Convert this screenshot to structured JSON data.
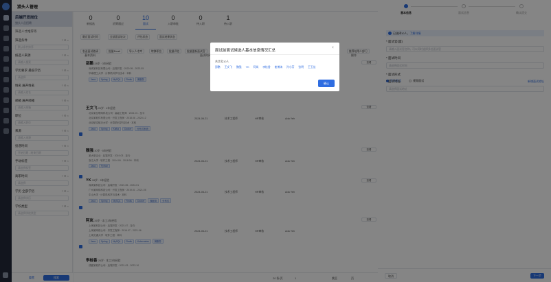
{
  "app": {
    "title": "猎头人管理"
  },
  "job": {
    "name": "后端开发岗位",
    "sub": "猎头人员招聘"
  },
  "filters": {
    "head": "筛选人才推荐等",
    "groups": [
      {
        "label": "筛选条件",
        "placeholder": "默认条件排序"
      },
      {
        "label": "候选人来源",
        "placeholder": "请输入搜索"
      },
      {
        "label": "学历要求 最低学历",
        "placeholder": "请选择"
      },
      {
        "label": "姓名 展开姓名",
        "placeholder": "请输入姓名"
      },
      {
        "label": "邮箱 展开邮箱",
        "placeholder": "请输入邮箱"
      },
      {
        "label": "职位",
        "placeholder": "请输入职位"
      },
      {
        "label": "来源",
        "placeholder": "请输入来源"
      },
      {
        "label": "投递时间",
        "placeholder": "开始日期 - 结束日期"
      },
      {
        "label": "手动标签",
        "placeholder": "请选择标签"
      },
      {
        "label": "离职时间",
        "placeholder": "请选择"
      },
      {
        "label": "学历 全部学历",
        "placeholder": "请选择学历"
      },
      {
        "label": "学校类型",
        "placeholder": "请选择学校类型"
      }
    ],
    "reset": "重置",
    "search": "搜索"
  },
  "stages": [
    {
      "num": "0",
      "label": "新候选"
    },
    {
      "num": "0",
      "label": "初筛通过"
    },
    {
      "num": "10",
      "label": "面试"
    },
    {
      "num": "0",
      "label": "入职审批"
    },
    {
      "num": "0",
      "label": "待入职"
    },
    {
      "num": "1",
      "label": "待入职"
    }
  ],
  "dropdowns": [
    "最近面试时间",
    "全部面试轮次",
    "评估状态",
    "面试结果状态"
  ],
  "tools": [
    "发送面试邀请",
    "批量Email",
    "导入人才库",
    "转移职位",
    "批量评估",
    "批量更新面试官",
    "筛选候选人",
    "推荐给用人部门"
  ],
  "colhead": {
    "name": "基本资料",
    "time": "面试时间",
    "pos": "应聘职位",
    "stage": "当前阶段",
    "owner": "推荐人",
    "action": "操作"
  },
  "candidates": [
    {
      "name": "邵鹏",
      "meta": "28岁 · 3年经验",
      "lines": [
        "深圳某科技有限公司 · 后端开发 · 2020.05 - 2023.05",
        "华南理工大学 · 计算机科学与技术 · 本科"
      ],
      "tags": [
        "Java",
        "Spring",
        "MySQL",
        "Redis",
        "微服务"
      ],
      "time": "",
      "pos": "",
      "stage": "",
      "owner": "",
      "action": "查看"
    },
    {
      "name": "王文飞",
      "meta": "26岁 · 4年经验",
      "lines": [
        "北京某互联网科技公司 · 高级工程师 · 2021.01 - 至今",
        "北京某软件有限公司 · 开发工程师 · 2018.06 - 2020.12",
        "北京航空航天大学 · 计算机科学与技术 · 本科"
      ],
      "tags": [
        "Java",
        "Spring",
        "Kafka",
        "Docker",
        "分布式系统"
      ],
      "time": "2024-06-21",
      "pos": "技术工程师",
      "stage": "HR审核",
      "owner": "Ada Yeh",
      "action": "查看"
    },
    {
      "name": "魏强",
      "meta": "30岁 · 5年经验",
      "lines": [
        "某大型企业 · 后端开发 · 2019.03 - 至今",
        "浙江大学 · 软件工程 · 2014.09 - 2018.06 · 本科"
      ],
      "tags": [
        "Java",
        "Python"
      ],
      "time": "2024-06-21",
      "pos": "技术工程师",
      "stage": "HR审核",
      "owner": "Ada Yeh",
      "action": "查看"
    },
    {
      "name": "YK",
      "meta": "28岁 · 3年经验",
      "lines": [
        "深圳某科技公司 · 后端开发 · 2021.05 - 2024.01",
        "广州某网络科技公司 · 开发工程师 · 2019.01 - 2021.05",
        "中山大学 · 计算机科学与技术 · 本科"
      ],
      "tags": [
        "Java",
        "Spring",
        "MySQL",
        "Redis",
        "Docker",
        "微服务",
        "分布式"
      ],
      "time": "2024-06-21",
      "pos": "技术工程师",
      "stage": "HR审核",
      "owner": "Ada Yeh",
      "action": "查看"
    },
    {
      "name": "阿岚",
      "meta": "26岁 · 本工3年经验",
      "lines": [
        "上海某科技公司 · 后端开发 · 2021.07 - 至今",
        "上海某网络公司 · 开发工程师 · 2019.07 - 2021.06",
        "上海交通大学 · 软件工程 · 本科"
      ],
      "tags": [
        "Java",
        "Spring",
        "MySQL",
        "Redis",
        "Kubernetes",
        "微服务"
      ],
      "time": "2024-06-21",
      "pos": "技术工程师",
      "stage": "HR审核",
      "owner": "Ada Yeh",
      "action": "查看"
    },
    {
      "name": "李桂香",
      "meta": "26岁 · 本工3年经验",
      "lines": [
        "成都某软件公司 · 后端开发 · 2021.03 - 2023.10"
      ],
      "tags": [],
      "time": "",
      "pos": "",
      "stage": "",
      "owner": "",
      "action": ""
    }
  ],
  "pager": {
    "size": "20 条/页",
    "page": "1",
    "goto": "跳至",
    "unit": "页"
  },
  "drawer": {
    "steps": [
      "基本信息",
      "面试信息",
      "确认提交"
    ],
    "info": "已选择10人，",
    "info_link": "了解详情",
    "sections": [
      {
        "title": "* 面试官(面)",
        "placeholder": "请输入面试官名称，可以同时选择多位面试官"
      },
      {
        "title": "* 面试时间",
        "placeholder": "请选择面试时间"
      },
      {
        "title": "* 面试地址",
        "placeholder": "请选择面试地址"
      }
    ],
    "mode_label": "* 面试形式",
    "mode_options": [
      "现场面试",
      "视频面试"
    ],
    "addr_link": "新增面试地址",
    "cancel": "取消",
    "next": "下一步"
  },
  "modal": {
    "title": "面试前面试候选人基本信息情况汇总",
    "count": "共涉及10人",
    "names": [
      "邵鹏",
      "王文飞",
      "魏强",
      "YK",
      "阿岚",
      "李桂香",
      "崔博涛",
      "孙小芳",
      "张明",
      "王玉佳"
    ],
    "ok": "确认",
    "close": "×"
  },
  "colors": {
    "primary": "#2f6de1",
    "rail": "#232a3a",
    "overlay": "rgba(0,0,0,0.48)"
  }
}
